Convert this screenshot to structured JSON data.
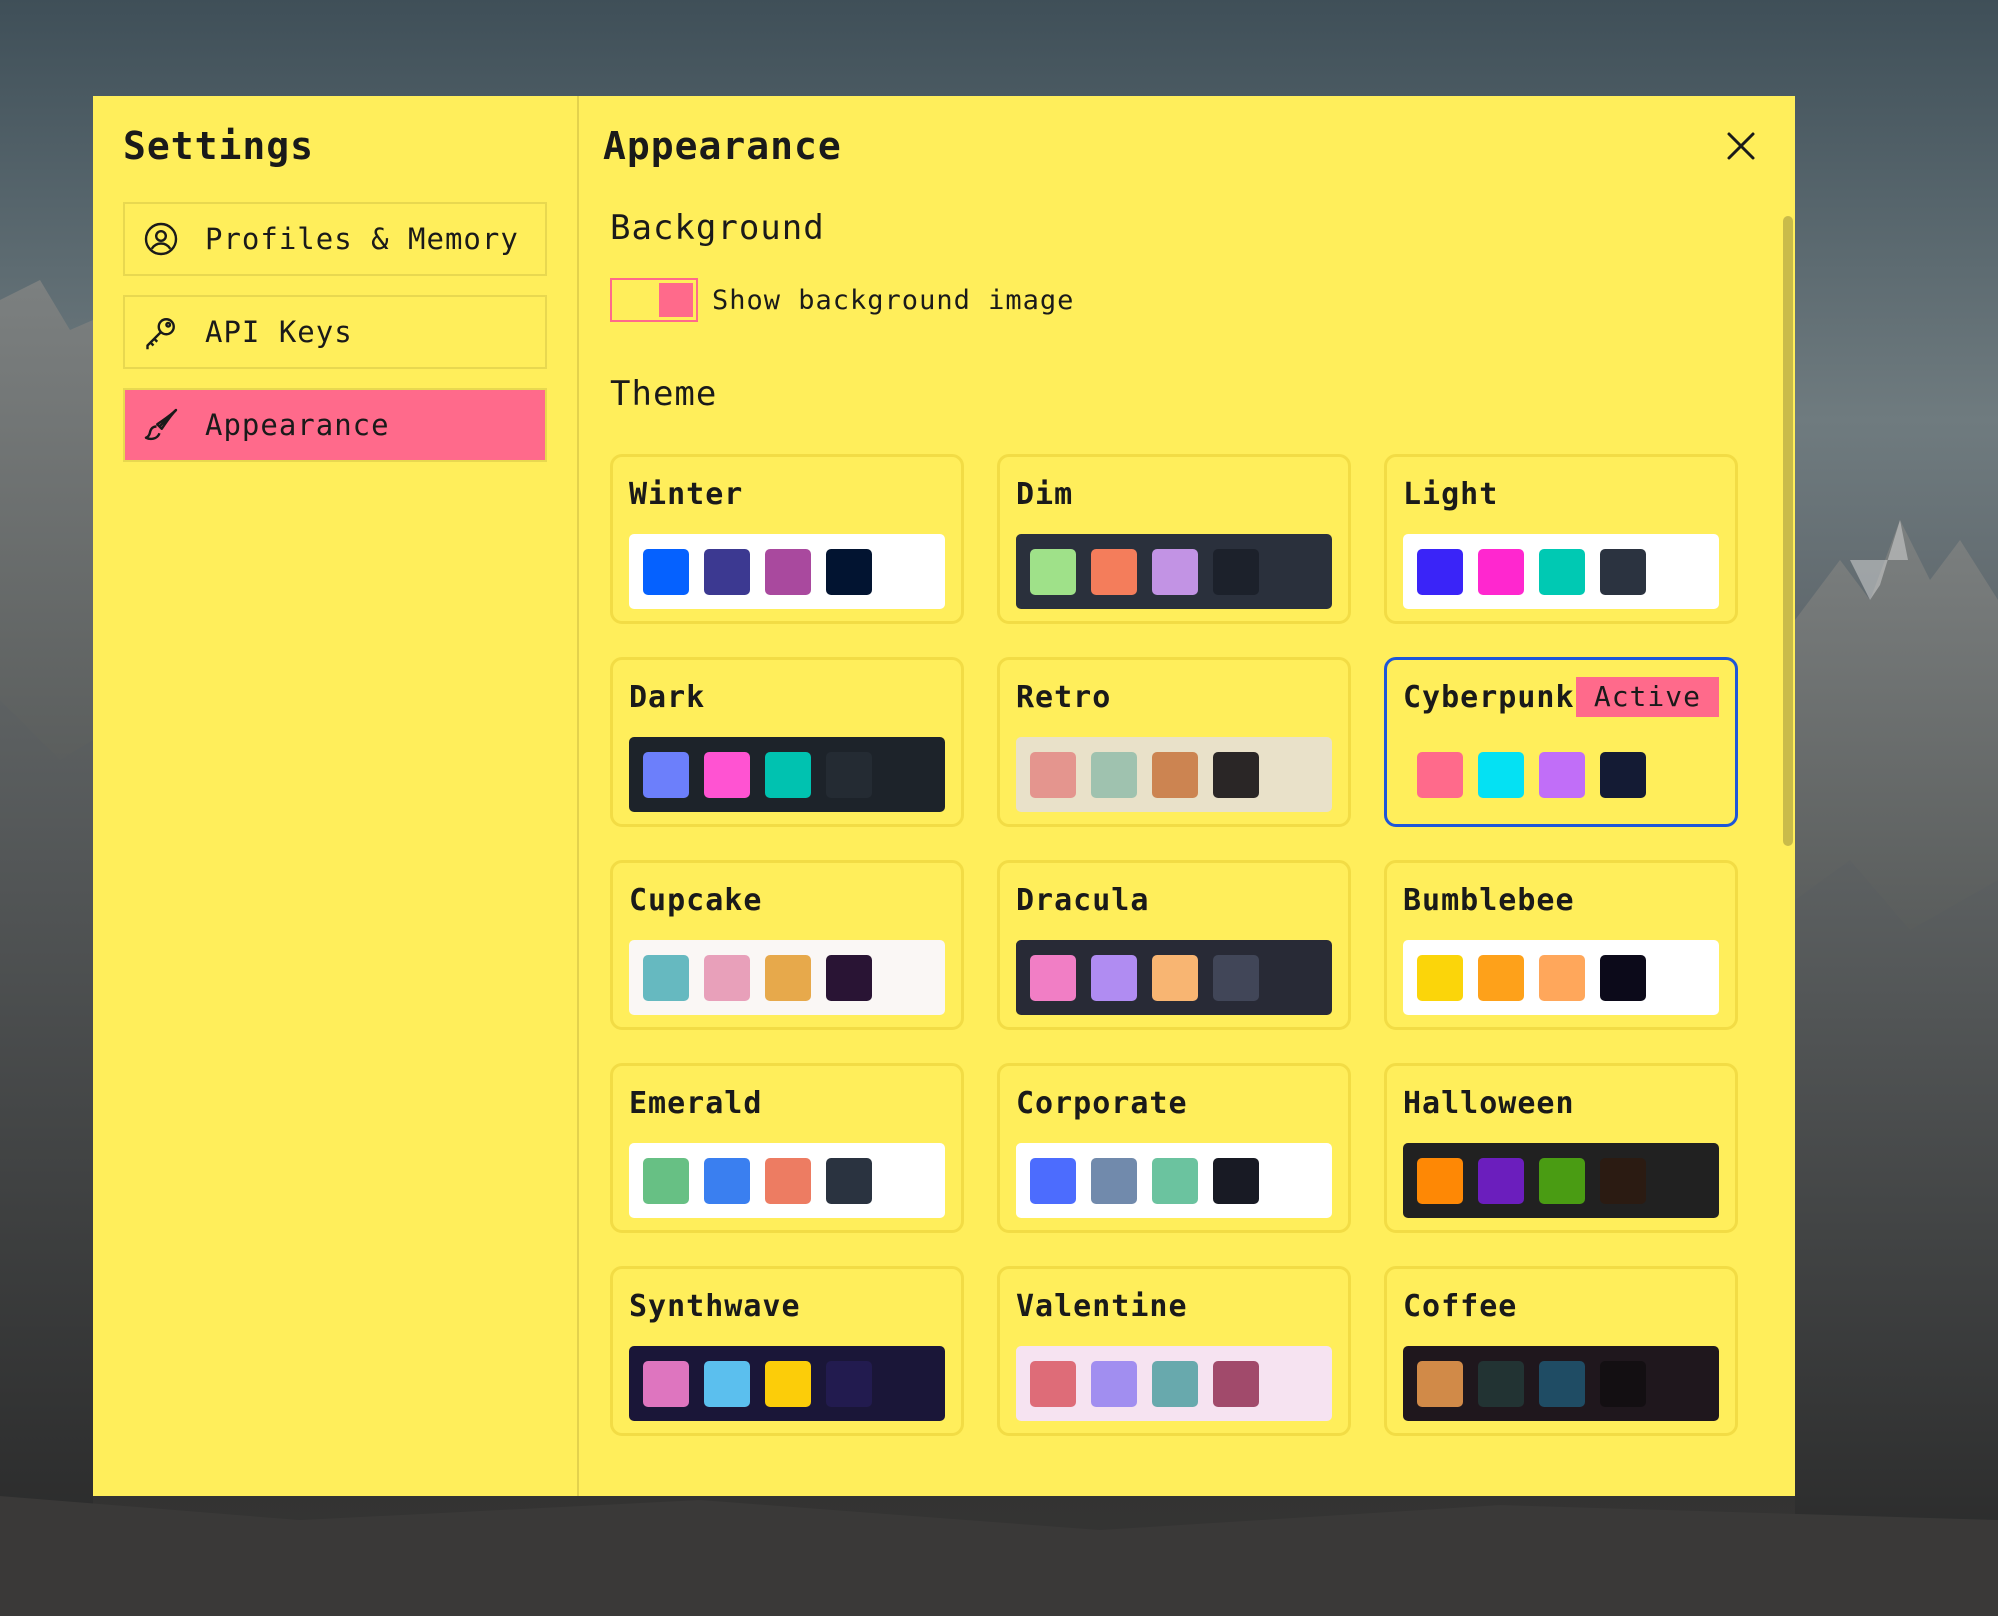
{
  "sidebar": {
    "title": "Settings",
    "items": [
      {
        "label": "Profiles & Memory",
        "icon": "user-circle-icon",
        "active": false
      },
      {
        "label": "API Keys",
        "icon": "key-icon",
        "active": false
      },
      {
        "label": "Appearance",
        "icon": "paintbrush-icon",
        "active": true
      }
    ]
  },
  "main": {
    "title": "Appearance",
    "close_icon": "close-icon",
    "background": {
      "heading": "Background",
      "toggle_label": "Show background image",
      "toggle_on": true
    },
    "theme": {
      "heading": "Theme",
      "active_badge": "Active",
      "themes": [
        {
          "name": "Winter",
          "bg": "#ffffff",
          "colors": [
            "#0561ff",
            "#3c3991",
            "#a9499e",
            "#021431"
          ]
        },
        {
          "name": "Dim",
          "bg": "#2a303c",
          "colors": [
            "#9fe189",
            "#f47d5b",
            "#c293e4",
            "#1c212b"
          ]
        },
        {
          "name": "Light",
          "bg": "#ffffff",
          "colors": [
            "#3a24f8",
            "#ff27cf",
            "#00c9b3",
            "#2b3340"
          ]
        },
        {
          "name": "Dark",
          "bg": "#1d232a",
          "colors": [
            "#6c7ffb",
            "#ff53d2",
            "#00c2b0",
            "#242b33"
          ]
        },
        {
          "name": "Retro",
          "bg": "#e9e1c9",
          "colors": [
            "#e4958e",
            "#9fc2af",
            "#cc8451",
            "#2a2626"
          ]
        },
        {
          "name": "Cyberpunk",
          "bg": "#ffee5b",
          "colors": [
            "#ff6a8b",
            "#04e1f3",
            "#c16ef8",
            "#141b34"
          ],
          "active": true
        },
        {
          "name": "Cupcake",
          "bg": "#faf7f5",
          "colors": [
            "#66b9c0",
            "#e8a0ba",
            "#e7a94b",
            "#291434"
          ]
        },
        {
          "name": "Dracula",
          "bg": "#282a36",
          "colors": [
            "#f17ec5",
            "#b08cf2",
            "#f8b572",
            "#414658"
          ]
        },
        {
          "name": "Bumblebee",
          "bg": "#ffffff",
          "colors": [
            "#fbd50a",
            "#fea11a",
            "#ffa75b",
            "#0c0a1a"
          ]
        },
        {
          "name": "Emerald",
          "bg": "#ffffff",
          "colors": [
            "#67c084",
            "#3a7ff0",
            "#ed7c62",
            "#2a3340"
          ]
        },
        {
          "name": "Corporate",
          "bg": "#ffffff",
          "colors": [
            "#4c6cfe",
            "#718aac",
            "#6bc39f",
            "#181a24"
          ]
        },
        {
          "name": "Halloween",
          "bg": "#212121",
          "colors": [
            "#fe8805",
            "#6b1ebd",
            "#4a9c13",
            "#2b1b12"
          ]
        },
        {
          "name": "Synthwave",
          "bg": "#1a1638",
          "colors": [
            "#de75bf",
            "#5bbfee",
            "#fccd09",
            "#221b4f"
          ]
        },
        {
          "name": "Valentine",
          "bg": "#f6e3f1",
          "colors": [
            "#de6c78",
            "#a18ef0",
            "#68a9ad",
            "#a14a6b"
          ]
        },
        {
          "name": "Coffee",
          "bg": "#1f171d",
          "colors": [
            "#d18a48",
            "#223333",
            "#1f4c64",
            "#130f12"
          ]
        }
      ]
    }
  },
  "colors": {
    "modal_bg": "#ffee5b",
    "accent": "#ff6a8b",
    "active_border": "#1e56d8"
  }
}
